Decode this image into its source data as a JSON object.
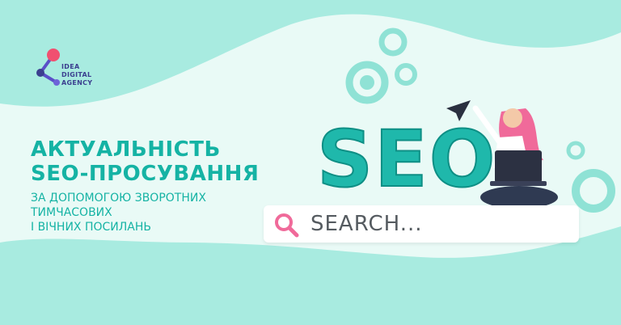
{
  "brand": {
    "line1": "IDEA",
    "line2": "DIGITAL",
    "line3": "AGENCY"
  },
  "headline": {
    "line1": "АКТУАЛЬНІСТЬ",
    "line2": "SEO-ПРОСУВАННЯ"
  },
  "subheadline": {
    "line1": "ЗА ДОПОМОГОЮ ЗВОРОТНИХ",
    "line2": "ТИМЧАСОВИХ",
    "line3": "І ВІЧНИХ ПОСИЛАНЬ"
  },
  "illustration": {
    "word": "SEO"
  },
  "search": {
    "text": "SEARCH..."
  },
  "colors": {
    "teal": "#15b3a4",
    "mint": "#a8ebe0",
    "gear": "#8fe2d5",
    "pink": "#f06a9a",
    "navy": "#3b3f8f"
  }
}
